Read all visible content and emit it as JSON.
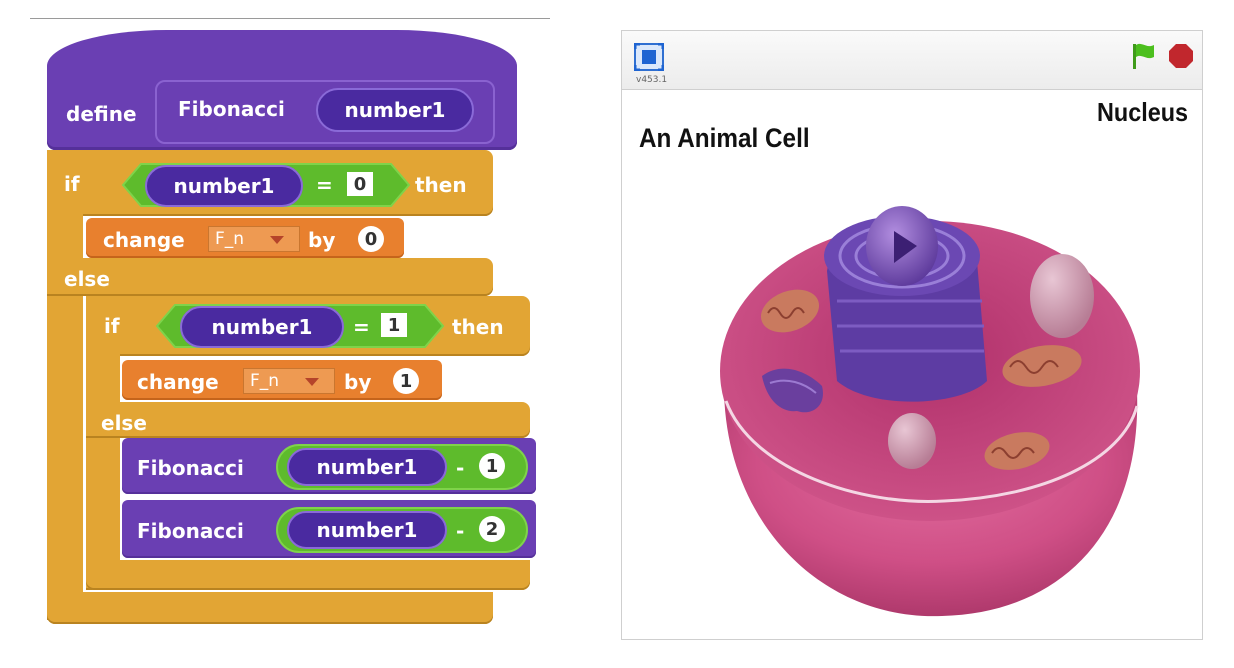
{
  "scripts": {
    "define_label": "define",
    "proc_name": "Fibonacci",
    "param": "number1",
    "if_label": "if",
    "then_label": "then",
    "else_label": "else",
    "eq_sign": "=",
    "minus_sign": "-",
    "if1_value": "0",
    "if2_value": "1",
    "change_label": "change",
    "by_label": "by",
    "variable": "F_n",
    "change1_value": "0",
    "change2_value": "1",
    "call1_minus": "1",
    "call2_minus": "2",
    "colors": {
      "events": "#6a3fb3",
      "control": "#e2a534",
      "operators": "#5ebb2c",
      "data": "#e8802e"
    }
  },
  "stage": {
    "version": "v453.1",
    "title": "An Animal Cell",
    "label_nucleus": "Nucleus",
    "icons": [
      "fullscreen-icon",
      "green-flag-icon",
      "stop-icon"
    ],
    "colors": {
      "flag": "#4cbf1e",
      "stop": "#c1272d"
    }
  }
}
